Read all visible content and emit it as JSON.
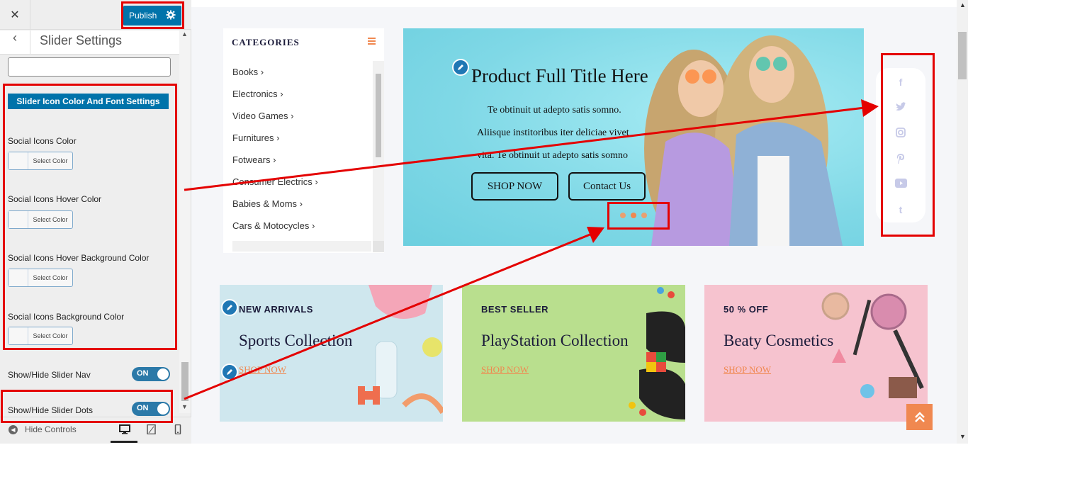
{
  "customizer": {
    "close_icon": "close-icon",
    "publish_label": "Publish",
    "publish_gear_icon": "gear-icon",
    "back_icon": "chevron-left-icon",
    "section_title": "Slider Settings",
    "search_value": "",
    "group_title": "Slider Icon Color And Font Settings",
    "options": [
      {
        "label": "Social Icons Color",
        "button": "Select Color"
      },
      {
        "label": "Social Icons Hover Color",
        "button": "Select Color"
      },
      {
        "label": "Social Icons Hover Background Color",
        "button": "Select Color"
      },
      {
        "label": "Social Icons Background Color",
        "button": "Select Color"
      }
    ],
    "toggles": [
      {
        "label": "Show/Hide Slider Nav",
        "state": "ON"
      },
      {
        "label": "Show/Hide Slider Dots",
        "state": "ON"
      }
    ],
    "footer": {
      "hide_controls": "Hide Controls",
      "devices": [
        "desktop-icon",
        "tablet-icon",
        "mobile-icon"
      ],
      "active_device": "desktop"
    }
  },
  "preview": {
    "categories": {
      "title": "CATEGORIES",
      "menu_icon": "hamburger-icon",
      "items": [
        "Books",
        "Electronics",
        "Video Games",
        "Furnitures",
        "Fotwears",
        "Consumer Electrics",
        "Babies & Moms",
        "Cars & Motocycles"
      ]
    },
    "hero": {
      "title": "Product Full Title Here",
      "lines": [
        "Te obtinuit ut adepto satis somno.",
        "Aliisque institoribus iter deliciae vivet",
        "vita. Te obtinuit ut adepto satis somno"
      ],
      "buttons": [
        "SHOP NOW",
        "Contact Us"
      ],
      "dots": 3,
      "active_dot": 1
    },
    "social_icons": [
      "facebook-icon",
      "twitter-icon",
      "instagram-icon",
      "pinterest-icon",
      "youtube-icon",
      "tumblr-icon"
    ],
    "promos": [
      {
        "tag": "NEW ARRIVALS",
        "title": "Sports Collection",
        "link": "SHOP NOW",
        "bg": "#cfe7ee"
      },
      {
        "tag": "BEST SELLER",
        "title": "PlayStation Collection",
        "link": "SHOP NOW",
        "bg": "#b9df8e"
      },
      {
        "tag": "50 % OFF",
        "title": "Beaty Cosmetics",
        "link": "SHOP NOW",
        "bg": "#f6c3cf"
      }
    ],
    "scroll_top_icon": "double-chevron-up-icon"
  },
  "colors": {
    "accent": "#0073aa",
    "orange": "#f08850",
    "annotation": "#e40000",
    "social_icon": "#c7cae8"
  }
}
